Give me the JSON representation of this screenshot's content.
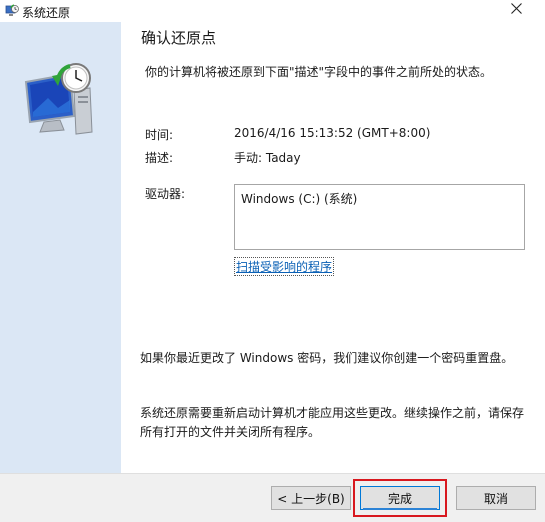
{
  "window": {
    "title": "系统还原",
    "close_glyph": "✕"
  },
  "main": {
    "heading": "确认还原点",
    "description": "你的计算机将被还原到下面\"描述\"字段中的事件之前所处的状态。",
    "fields": {
      "time_label": "时间:",
      "time_value": "2016/4/16 15:13:52 (GMT+8:00)",
      "desc_label": "描述:",
      "desc_value": "手动: Taday",
      "drives_label": "驱动器:",
      "drives": [
        "Windows (C:) (系统)"
      ]
    },
    "scan_link": "扫描受影响的程序",
    "password_note": "如果你最近更改了 Windows 密码，我们建议你创建一个密码重置盘。",
    "restart_note": "系统还原需要重新启动计算机才能应用这些更改。继续操作之前，请保存所有打开的文件并关闭所有程序。"
  },
  "footer": {
    "back_label": "< 上一步(B)",
    "finish_label": "完成",
    "cancel_label": "取消"
  },
  "colors": {
    "left_panel": "#dbe7f5",
    "link": "#0a60b5",
    "highlight": "#d8181f",
    "footer": "#f0f0f0"
  },
  "icons": {
    "title_icon": "system-restore-icon",
    "hero_icon": "computer-restore-icon",
    "close_icon": "close-icon"
  }
}
